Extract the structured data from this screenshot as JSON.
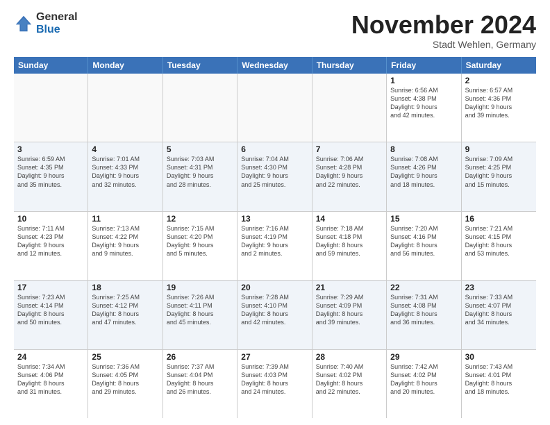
{
  "logo": {
    "general": "General",
    "blue": "Blue"
  },
  "header": {
    "month": "November 2024",
    "location": "Stadt Wehlen, Germany"
  },
  "weekdays": [
    "Sunday",
    "Monday",
    "Tuesday",
    "Wednesday",
    "Thursday",
    "Friday",
    "Saturday"
  ],
  "weeks": [
    [
      {
        "day": "",
        "info": "",
        "empty": true
      },
      {
        "day": "",
        "info": "",
        "empty": true
      },
      {
        "day": "",
        "info": "",
        "empty": true
      },
      {
        "day": "",
        "info": "",
        "empty": true
      },
      {
        "day": "",
        "info": "",
        "empty": true
      },
      {
        "day": "1",
        "info": "Sunrise: 6:56 AM\nSunset: 4:38 PM\nDaylight: 9 hours\nand 42 minutes."
      },
      {
        "day": "2",
        "info": "Sunrise: 6:57 AM\nSunset: 4:36 PM\nDaylight: 9 hours\nand 39 minutes."
      }
    ],
    [
      {
        "day": "3",
        "info": "Sunrise: 6:59 AM\nSunset: 4:35 PM\nDaylight: 9 hours\nand 35 minutes."
      },
      {
        "day": "4",
        "info": "Sunrise: 7:01 AM\nSunset: 4:33 PM\nDaylight: 9 hours\nand 32 minutes."
      },
      {
        "day": "5",
        "info": "Sunrise: 7:03 AM\nSunset: 4:31 PM\nDaylight: 9 hours\nand 28 minutes."
      },
      {
        "day": "6",
        "info": "Sunrise: 7:04 AM\nSunset: 4:30 PM\nDaylight: 9 hours\nand 25 minutes."
      },
      {
        "day": "7",
        "info": "Sunrise: 7:06 AM\nSunset: 4:28 PM\nDaylight: 9 hours\nand 22 minutes."
      },
      {
        "day": "8",
        "info": "Sunrise: 7:08 AM\nSunset: 4:26 PM\nDaylight: 9 hours\nand 18 minutes."
      },
      {
        "day": "9",
        "info": "Sunrise: 7:09 AM\nSunset: 4:25 PM\nDaylight: 9 hours\nand 15 minutes."
      }
    ],
    [
      {
        "day": "10",
        "info": "Sunrise: 7:11 AM\nSunset: 4:23 PM\nDaylight: 9 hours\nand 12 minutes."
      },
      {
        "day": "11",
        "info": "Sunrise: 7:13 AM\nSunset: 4:22 PM\nDaylight: 9 hours\nand 9 minutes."
      },
      {
        "day": "12",
        "info": "Sunrise: 7:15 AM\nSunset: 4:20 PM\nDaylight: 9 hours\nand 5 minutes."
      },
      {
        "day": "13",
        "info": "Sunrise: 7:16 AM\nSunset: 4:19 PM\nDaylight: 9 hours\nand 2 minutes."
      },
      {
        "day": "14",
        "info": "Sunrise: 7:18 AM\nSunset: 4:18 PM\nDaylight: 8 hours\nand 59 minutes."
      },
      {
        "day": "15",
        "info": "Sunrise: 7:20 AM\nSunset: 4:16 PM\nDaylight: 8 hours\nand 56 minutes."
      },
      {
        "day": "16",
        "info": "Sunrise: 7:21 AM\nSunset: 4:15 PM\nDaylight: 8 hours\nand 53 minutes."
      }
    ],
    [
      {
        "day": "17",
        "info": "Sunrise: 7:23 AM\nSunset: 4:14 PM\nDaylight: 8 hours\nand 50 minutes."
      },
      {
        "day": "18",
        "info": "Sunrise: 7:25 AM\nSunset: 4:12 PM\nDaylight: 8 hours\nand 47 minutes."
      },
      {
        "day": "19",
        "info": "Sunrise: 7:26 AM\nSunset: 4:11 PM\nDaylight: 8 hours\nand 45 minutes."
      },
      {
        "day": "20",
        "info": "Sunrise: 7:28 AM\nSunset: 4:10 PM\nDaylight: 8 hours\nand 42 minutes."
      },
      {
        "day": "21",
        "info": "Sunrise: 7:29 AM\nSunset: 4:09 PM\nDaylight: 8 hours\nand 39 minutes."
      },
      {
        "day": "22",
        "info": "Sunrise: 7:31 AM\nSunset: 4:08 PM\nDaylight: 8 hours\nand 36 minutes."
      },
      {
        "day": "23",
        "info": "Sunrise: 7:33 AM\nSunset: 4:07 PM\nDaylight: 8 hours\nand 34 minutes."
      }
    ],
    [
      {
        "day": "24",
        "info": "Sunrise: 7:34 AM\nSunset: 4:06 PM\nDaylight: 8 hours\nand 31 minutes."
      },
      {
        "day": "25",
        "info": "Sunrise: 7:36 AM\nSunset: 4:05 PM\nDaylight: 8 hours\nand 29 minutes."
      },
      {
        "day": "26",
        "info": "Sunrise: 7:37 AM\nSunset: 4:04 PM\nDaylight: 8 hours\nand 26 minutes."
      },
      {
        "day": "27",
        "info": "Sunrise: 7:39 AM\nSunset: 4:03 PM\nDaylight: 8 hours\nand 24 minutes."
      },
      {
        "day": "28",
        "info": "Sunrise: 7:40 AM\nSunset: 4:02 PM\nDaylight: 8 hours\nand 22 minutes."
      },
      {
        "day": "29",
        "info": "Sunrise: 7:42 AM\nSunset: 4:02 PM\nDaylight: 8 hours\nand 20 minutes."
      },
      {
        "day": "30",
        "info": "Sunrise: 7:43 AM\nSunset: 4:01 PM\nDaylight: 8 hours\nand 18 minutes."
      }
    ]
  ]
}
